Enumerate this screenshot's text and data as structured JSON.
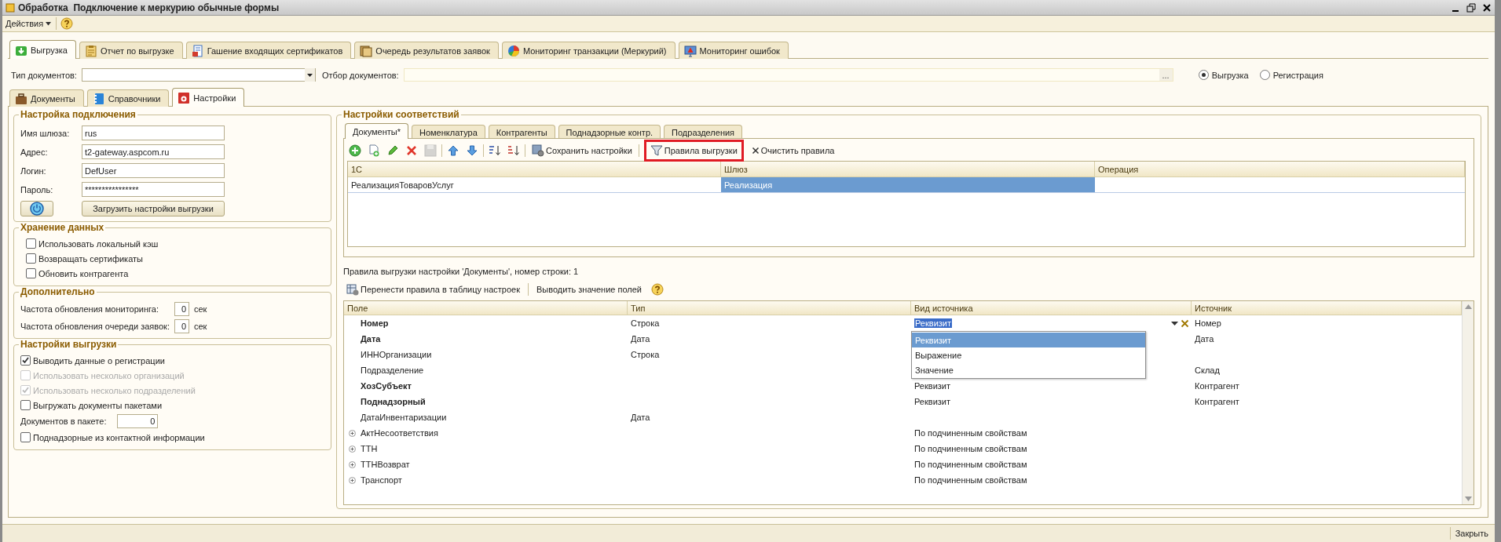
{
  "window": {
    "title": "Обработка  Подключение к меркурию обычные формы"
  },
  "menu": {
    "actions": "Действия"
  },
  "main_tabs": [
    {
      "label": "Выгрузка",
      "selected": true
    },
    {
      "label": "Отчет по выгрузке",
      "selected": false
    },
    {
      "label": "Гашение входящих сертификатов",
      "selected": false
    },
    {
      "label": "Очередь результатов заявок",
      "selected": false
    },
    {
      "label": "Мониторинг транзакции (Меркурий)",
      "selected": false
    },
    {
      "label": "Мониторинг ошибок",
      "selected": false
    }
  ],
  "filter": {
    "doc_type_label": "Тип документов:",
    "doc_filter_label": "Отбор документов:",
    "more": "...",
    "modes": [
      {
        "label": "Выгрузка",
        "selected": true
      },
      {
        "label": "Регистрация",
        "selected": false
      }
    ]
  },
  "sub_tabs": [
    {
      "label": "Документы",
      "selected": false
    },
    {
      "label": "Справочники",
      "selected": false
    },
    {
      "label": "Настройки",
      "selected": true
    }
  ],
  "connection": {
    "title": "Настройка подключения",
    "fields": [
      {
        "label": "Имя шлюза:",
        "value": "rus"
      },
      {
        "label": "Адрес:",
        "value": "t2-gateway.aspcom.ru"
      },
      {
        "label": "Логин:",
        "value": "DefUser"
      },
      {
        "label": "Пароль:",
        "value": "****************"
      }
    ],
    "load_button": "Загрузить настройки выгрузки"
  },
  "storage": {
    "title": "Хранение данных",
    "options": [
      {
        "label": "Использовать локальный кэш",
        "checked": false
      },
      {
        "label": "Возвращать сертификаты",
        "checked": false
      },
      {
        "label": "Обновить контрагента",
        "checked": false
      }
    ]
  },
  "extra": {
    "title": "Дополнительно",
    "fields": [
      {
        "label": "Частота обновления мониторинга:",
        "value": "0",
        "unit": "сек"
      },
      {
        "label": "Частота обновления очереди заявок:",
        "value": "0",
        "unit": "сек"
      }
    ]
  },
  "export_settings": {
    "title": "Настройки выгрузки",
    "items": [
      {
        "kind": "checkbox",
        "label": "Выводить данные о регистрации",
        "checked": true,
        "disabled": false
      },
      {
        "kind": "checkbox",
        "label": "Использовать несколько организаций",
        "checked": false,
        "disabled": true
      },
      {
        "kind": "checkbox",
        "label": "Использовать несколько подразделений",
        "checked": true,
        "disabled": true
      },
      {
        "kind": "checkbox",
        "label": "Выгружать документы пакетами",
        "checked": false,
        "disabled": false
      },
      {
        "kind": "number",
        "label": "Документов в пакете:",
        "value": "0"
      },
      {
        "kind": "checkbox",
        "label": "Поднадзорные из контактной информации",
        "checked": false,
        "disabled": false
      }
    ]
  },
  "mapping": {
    "title": "Настройки соответствий",
    "tabs": [
      {
        "label": "Документы*",
        "selected": true
      },
      {
        "label": "Номенклатура",
        "selected": false
      },
      {
        "label": "Контрагенты",
        "selected": false
      },
      {
        "label": "Поднадзорные контр.",
        "selected": false
      },
      {
        "label": "Подразделения",
        "selected": false
      }
    ],
    "toolbar": {
      "save": "Сохранить настройки",
      "rules": "Правила выгрузки",
      "rules_highlighted": true,
      "clear": "Очистить правила"
    },
    "table": {
      "columns": [
        "1С",
        "Шлюз",
        "Операция"
      ],
      "rows": [
        {
          "cells": [
            {
              "text": "РеализацияТоваровУслуг",
              "selected": false
            },
            {
              "text": "Реализация",
              "selected": true
            }
          ]
        }
      ]
    }
  },
  "rules": {
    "caption": "Правила выгрузки настройки 'Документы', номер строки: 1",
    "toolbar": {
      "transfer": "Перенести правила в таблицу настроек",
      "show_values": "Выводить значение полей"
    },
    "table": {
      "columns": [
        "Поле",
        "Тип",
        "Вид источника",
        "Источник"
      ],
      "rows": [
        {
          "field": "Номер",
          "bold": true,
          "expandable": false,
          "editing": true,
          "type": "Строка",
          "source_kind": "Реквизит",
          "source": "Номер"
        },
        {
          "field": "Дата",
          "bold": true,
          "expandable": false,
          "editing": false,
          "type": "Дата",
          "source": "Дата"
        },
        {
          "field": "ИННОрганизации",
          "bold": false,
          "expandable": false,
          "editing": false,
          "type": "Строка"
        },
        {
          "field": "Подразделение",
          "bold": false,
          "expandable": false,
          "editing": false,
          "source": "Склад"
        },
        {
          "field": "ХозСубъект",
          "bold": true,
          "expandable": false,
          "editing": false,
          "source_kind": "Реквизит",
          "source": "Контрагент"
        },
        {
          "field": "Поднадзорный",
          "bold": true,
          "expandable": false,
          "editing": false,
          "source_kind": "Реквизит",
          "source": "Контрагент"
        },
        {
          "field": "ДатаИнвентаризации",
          "bold": false,
          "expandable": false,
          "editing": false,
          "type": "Дата"
        },
        {
          "field": "АктНесоответствия",
          "bold": false,
          "expandable": true,
          "editing": false,
          "source_kind": "По подчиненным свойствам"
        },
        {
          "field": "ТТН",
          "bold": false,
          "expandable": true,
          "editing": false,
          "source_kind": "По подчиненным свойствам"
        },
        {
          "field": "ТТНВозврат",
          "bold": false,
          "expandable": true,
          "editing": false,
          "source_kind": "По подчиненным свойствам"
        },
        {
          "field": "Транспорт",
          "bold": false,
          "expandable": true,
          "editing": false,
          "source_kind": "По подчиненным свойствам"
        }
      ]
    },
    "dropdown": {
      "options": [
        {
          "label": "Реквизит",
          "selected": true
        },
        {
          "label": "Выражение",
          "selected": false
        },
        {
          "label": "Значение",
          "selected": false
        }
      ]
    }
  },
  "status_bar": {
    "close": "Закрыть"
  }
}
